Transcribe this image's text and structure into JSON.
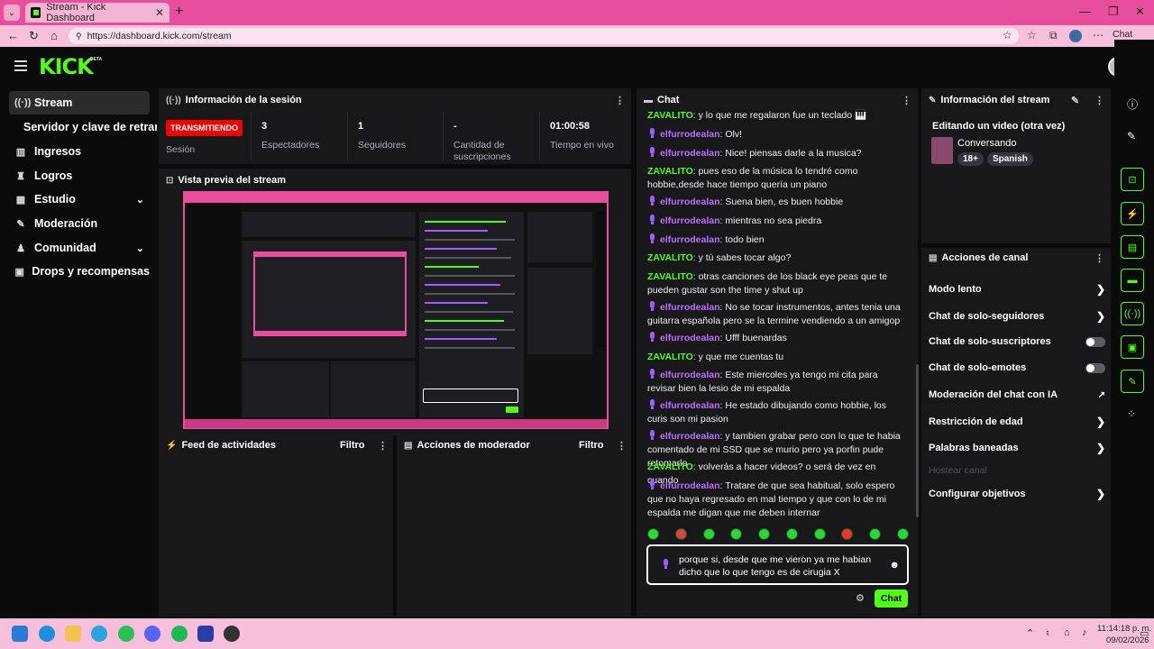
{
  "browser": {
    "tab_title": "Stream - Kick Dashboard",
    "url": "https://dashboard.kick.com/stream",
    "chat_label": "Chat"
  },
  "brand": {
    "logo": "KICK",
    "beta": "BETA",
    "accent": "#53fc18"
  },
  "sidebar": {
    "items": [
      {
        "label": "Stream",
        "icon": "broadcast-icon"
      },
      {
        "label": "Servidor y clave de retransmisión",
        "icon": ""
      },
      {
        "label": "Ingresos",
        "icon": "chart-icon"
      },
      {
        "label": "Logros",
        "icon": "trophy-icon"
      },
      {
        "label": "Estudio",
        "icon": "studio-icon"
      },
      {
        "label": "Moderación",
        "icon": "wrench-icon"
      },
      {
        "label": "Comunidad",
        "icon": "community-icon"
      },
      {
        "label": "Drops y recompensas",
        "icon": "gift-icon"
      }
    ]
  },
  "session": {
    "title": "Información de la sesión",
    "status": "TRANSMITIENDO",
    "stats": [
      {
        "value": "",
        "label": "Sesión"
      },
      {
        "value": "3",
        "label": "Espectadores"
      },
      {
        "value": "1",
        "label": "Seguidores"
      },
      {
        "value": "-",
        "label": "Cantidad de suscripciones"
      },
      {
        "value": "01:00:58",
        "label": "Tiempo en vivo"
      }
    ]
  },
  "preview": {
    "title": "Vista previa del stream"
  },
  "feed": {
    "title": "Feed de actividades",
    "filter": "Filtro"
  },
  "modactions": {
    "title": "Acciones de moderador",
    "filter": "Filtro"
  },
  "chat": {
    "title": "Chat",
    "messages": [
      {
        "user": "ZAVALITO",
        "color": "green",
        "text": "y lo que me regalaron fue un teclado 🎹"
      },
      {
        "user": "elfurrodealan",
        "color": "purple",
        "text": "Olv!"
      },
      {
        "user": "elfurrodealan",
        "color": "purple",
        "text": "Nice! piensas darle a la musica?"
      },
      {
        "user": "ZAVALITO",
        "color": "green",
        "text": "pues eso de la música lo tendré como hobbie,desde hace tiempo quería un piano"
      },
      {
        "user": "elfurrodealan",
        "color": "purple",
        "text": "Suena bien, es buen hobbie"
      },
      {
        "user": "elfurrodealan",
        "color": "purple",
        "text": "mientras no sea piedra"
      },
      {
        "user": "elfurrodealan",
        "color": "purple",
        "text": "todo bien"
      },
      {
        "user": "ZAVALITO",
        "color": "green",
        "text": "y tú sabes tocar algo?"
      },
      {
        "user": "ZAVALITO",
        "color": "green",
        "text": "otras canciones de los black eye peas que te pueden gustar son the time y shut up"
      },
      {
        "user": "elfurrodealan",
        "color": "purple",
        "text": "No se tocar instrumentos, antes tenia una guitarra española pero se la termine vendiendo a un amigop"
      },
      {
        "user": "elfurrodealan",
        "color": "purple",
        "text": "Ufff buenardas"
      },
      {
        "user": "ZAVALITO",
        "color": "green",
        "text": "y que me cuentas tu"
      },
      {
        "user": "elfurrodealan",
        "color": "purple",
        "text": "Este miercoles ya tengo mi cita para revisar bien la lesio de mi espalda"
      },
      {
        "user": "elfurrodealan",
        "color": "purple",
        "text": "He estado dibujando como hobbie, los curis son mi pasion"
      },
      {
        "user": "elfurrodealan",
        "color": "purple",
        "text": "y tambien grabar pero con lo que te habia comentado de mi SSD que se murio pero ya porfin pude retomarlo"
      },
      {
        "user": "ZAVALITO",
        "color": "green",
        "text": "volverás a hacer videos? o será de vez en cuando"
      },
      {
        "user": "elfurrodealan",
        "color": "purple",
        "text": "Tratare de que sea habitual, solo espero que no haya regresado en mal tiempo y que con lo de mi espalda me digan que me deben internar"
      }
    ],
    "input_value": "porque si, desde que me vieron ya me habian dicho que lo que tengo es de cirugia X",
    "send_label": "Chat"
  },
  "streaminfo": {
    "title": "Información del stream",
    "stream_title": "Editando un video (otra vez)",
    "category": "Conversando",
    "tags": [
      "18+",
      "Spanish"
    ]
  },
  "channel": {
    "title": "Acciones de canal",
    "rows": [
      {
        "label": "Modo lento",
        "kind": "arrow"
      },
      {
        "label": "Chat de solo-seguidores",
        "kind": "arrow"
      },
      {
        "label": "Chat de solo-suscriptores",
        "kind": "toggle"
      },
      {
        "label": "Chat de solo-emotes",
        "kind": "toggle"
      },
      {
        "label": "Moderación del chat con IA",
        "kind": "external"
      },
      {
        "label": "Restricción de edad",
        "kind": "arrow"
      },
      {
        "label": "Palabras baneadas",
        "kind": "arrow"
      },
      {
        "label": "Hostear canal",
        "kind": "disabled"
      },
      {
        "label": "Configurar objetivos",
        "kind": "arrow"
      }
    ]
  },
  "taskbar": {
    "time": "11:14:18 p. m.",
    "date": "09/02/2026"
  }
}
